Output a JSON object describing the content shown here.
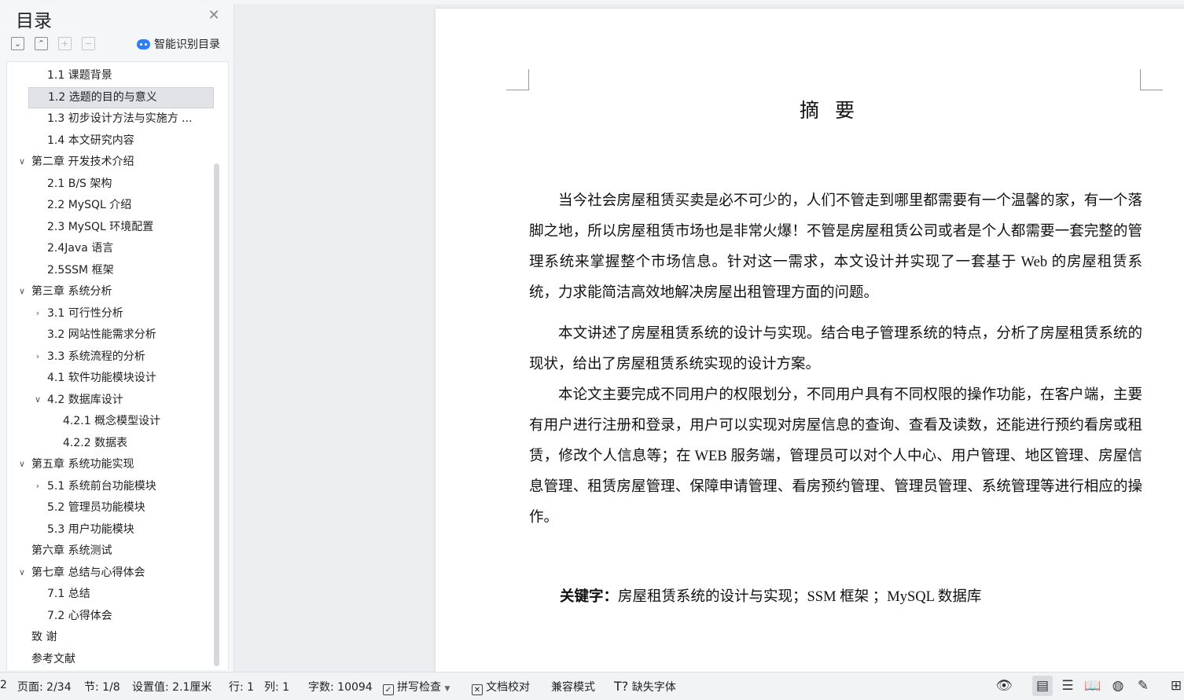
{
  "sidebar": {
    "title": "目录",
    "smart_toc_label": "智能识别目录",
    "toc": [
      {
        "label": "1.1  课题背景",
        "level": 2,
        "arrow": ""
      },
      {
        "label": "1.2  选题的目的与意义",
        "level": 2,
        "arrow": "",
        "selected": true
      },
      {
        "label": "1.3  初步设计方法与实施方 ...",
        "level": 2,
        "arrow": ""
      },
      {
        "label": "1.4  本文研究内容",
        "level": 2,
        "arrow": ""
      },
      {
        "label": "第二章  开发技术介绍",
        "level": 1,
        "arrow": "expanded"
      },
      {
        "label": "2.1 B/S 架构",
        "level": 2,
        "arrow": ""
      },
      {
        "label": "2.2 MySQL 介绍",
        "level": 2,
        "arrow": ""
      },
      {
        "label": "2.3 MySQL 环境配置",
        "level": 2,
        "arrow": ""
      },
      {
        "label": "2.4Java 语言",
        "level": 2,
        "arrow": ""
      },
      {
        "label": "2.5SSM 框架",
        "level": 2,
        "arrow": ""
      },
      {
        "label": "第三章  系统分析",
        "level": 1,
        "arrow": "expanded"
      },
      {
        "label": "3.1 可行性分析",
        "level": 2,
        "arrow": "collapsed"
      },
      {
        "label": "3.2 网站性能需求分析",
        "level": 2,
        "arrow": ""
      },
      {
        "label": "3.3 系统流程的分析",
        "level": 2,
        "arrow": "collapsed"
      },
      {
        "label": "4.1  软件功能模块设计",
        "level": 2,
        "arrow": ""
      },
      {
        "label": "4.2  数据库设计",
        "level": 2,
        "arrow": "expanded"
      },
      {
        "label": "4.2.1  概念模型设计",
        "level": 3,
        "arrow": ""
      },
      {
        "label": "4.2.2 数据表",
        "level": 3,
        "arrow": ""
      },
      {
        "label": "第五章  系统功能实现",
        "level": 1,
        "arrow": "expanded"
      },
      {
        "label": "5.1 系统前台功能模块",
        "level": 2,
        "arrow": "collapsed"
      },
      {
        "label": "5.2 管理员功能模块",
        "level": 2,
        "arrow": ""
      },
      {
        "label": "5.3 用户功能模块",
        "level": 2,
        "arrow": ""
      },
      {
        "label": "第六章  系统测试",
        "level": 1,
        "arrow": ""
      },
      {
        "label": "第七章  总结与心得体会",
        "level": 1,
        "arrow": "expanded"
      },
      {
        "label": "7.1 总结",
        "level": 2,
        "arrow": ""
      },
      {
        "label": "7.2 心得体会",
        "level": 2,
        "arrow": ""
      },
      {
        "label": "致    谢",
        "level": 1,
        "arrow": ""
      },
      {
        "label": "参考文献",
        "level": 1,
        "arrow": ""
      }
    ]
  },
  "document": {
    "title": "摘要",
    "paragraphs": [
      "当今社会房屋租赁买卖是必不可少的，人们不管走到哪里都需要有一个温馨的家，有一个落脚之地，所以房屋租赁市场也是非常火爆！不管是房屋租赁公司或者是个人都需要一套完整的管理系统来掌握整个市场信息。针对这一需求，本文设计并实现了一套基于 Web 的房屋租赁系统，力求能简洁高效地解决房屋出租管理方面的问题。",
      "本文讲述了房屋租赁系统的设计与实现。结合电子管理系统的特点，分析了房屋租赁系统的现状，给出了房屋租赁系统实现的设计方案。",
      "本论文主要完成不同用户的权限划分，不同用户具有不同权限的操作功能，在客户端，主要有用户进行注册和登录，用户可以实现对房屋信息的查询、查看及读数，还能进行预约看房或租赁，修改个人信息等；在 WEB 服务端，管理员可以对个人中心、用户管理、地区管理、房屋信息管理、租赁房屋管理、保障申请管理、看房预约管理、管理员管理、系统管理等进行相应的操作。"
    ],
    "keywords_label": "关键字：",
    "keywords_text": "房屋租赁系统的设计与实现；SSM 框架 ；MySQL 数据库"
  },
  "statusbar": {
    "edge": "2",
    "page": "页面: 2/34",
    "section": "节: 1/8",
    "setting": "设置值: 2.1厘米",
    "row": "行: 1",
    "col": "列: 1",
    "wordcount": "字数: 10094",
    "spellcheck": "拼写检查",
    "proofread": "文档校对",
    "compat": "兼容模式",
    "missing_font": "缺失字体"
  }
}
